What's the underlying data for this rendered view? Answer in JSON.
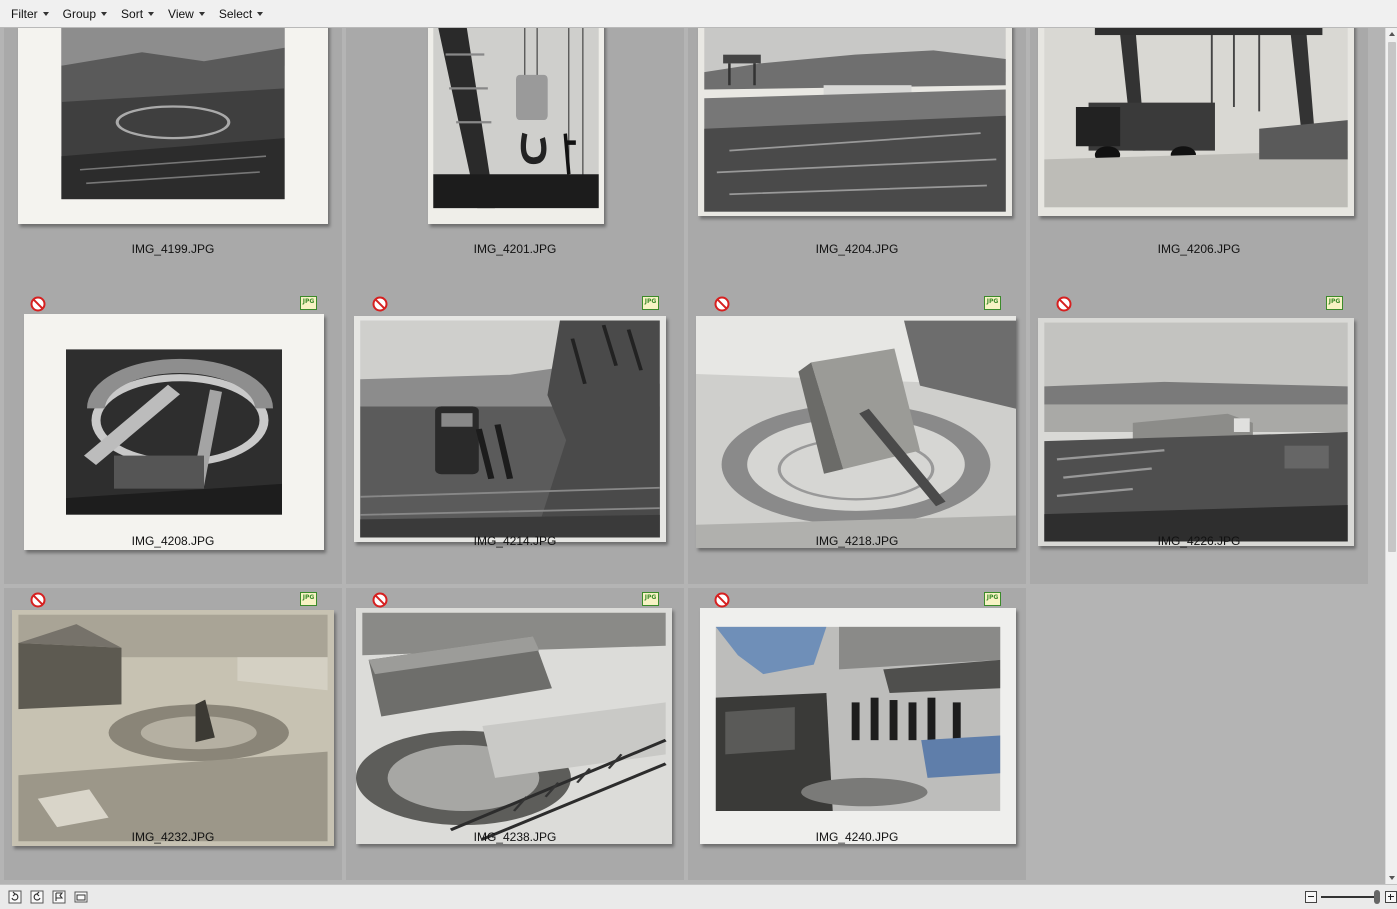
{
  "toolbar": {
    "menus": [
      {
        "label": "Filter"
      },
      {
        "label": "Group"
      },
      {
        "label": "Sort"
      },
      {
        "label": "View"
      },
      {
        "label": "Select"
      }
    ]
  },
  "thumbnails": [
    {
      "filename": "IMG_4199.JPG",
      "rejected": false,
      "badge": false,
      "scene": "bay-site"
    },
    {
      "filename": "IMG_4201.JPG",
      "rejected": false,
      "badge": false,
      "scene": "crane-hook"
    },
    {
      "filename": "IMG_4204.JPG",
      "rejected": false,
      "badge": false,
      "scene": "construction-landscape"
    },
    {
      "filename": "IMG_4206.JPG",
      "rejected": false,
      "badge": false,
      "scene": "gantry-crane"
    },
    {
      "filename": "IMG_4208.JPG",
      "rejected": true,
      "badge": true,
      "badge_text": "JPG",
      "scene": "gun-pit"
    },
    {
      "filename": "IMG_4214.JPG",
      "rejected": true,
      "badge": true,
      "badge_text": "JPG",
      "scene": "rail-wagon"
    },
    {
      "filename": "IMG_4218.JPG",
      "rejected": true,
      "badge": true,
      "badge_text": "JPG",
      "scene": "gun-turret"
    },
    {
      "filename": "IMG_4226.JPG",
      "rejected": true,
      "badge": true,
      "badge_text": "JPG",
      "scene": "coast-view"
    },
    {
      "filename": "IMG_4232.JPG",
      "rejected": true,
      "badge": true,
      "badge_text": "JPG",
      "scene": "stone-emplacement"
    },
    {
      "filename": "IMG_4238.JPG",
      "rejected": true,
      "badge": true,
      "badge_text": "JPG",
      "scene": "sheds-rails"
    },
    {
      "filename": "IMG_4240.JPG",
      "rejected": true,
      "badge": true,
      "badge_text": "JPG",
      "scene": "gun-crew"
    }
  ],
  "icons": {
    "reject": "reject-icon",
    "badge": "jpg-file-icon",
    "statusbar": [
      "rotate-left-icon",
      "rotate-right-icon",
      "flag-icon",
      "window-icon"
    ]
  },
  "colors": {
    "reject_red": "#d62020",
    "badge_green": "#3b8a2a",
    "cell_bg": "#a9a9a9",
    "grid_bg": "#b4b4b4"
  }
}
